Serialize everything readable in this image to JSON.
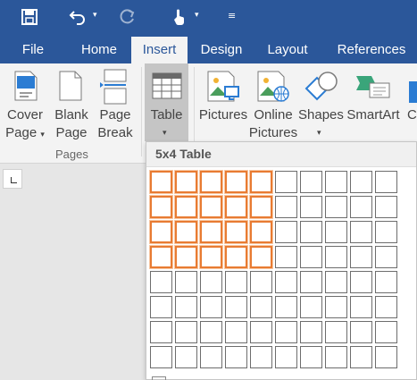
{
  "quick_access": {
    "save_icon": "save-icon",
    "undo_icon": "undo-icon",
    "redo_icon": "redo-icon",
    "touch_icon": "touch-mode-icon",
    "customize_icon": "customize-icon"
  },
  "tabs": [
    {
      "label": "File",
      "active": false
    },
    {
      "label": "Home",
      "active": false
    },
    {
      "label": "Insert",
      "active": true
    },
    {
      "label": "Design",
      "active": false
    },
    {
      "label": "Layout",
      "active": false
    },
    {
      "label": "References",
      "active": false
    }
  ],
  "ribbon": {
    "cover_page": {
      "line1": "Cover",
      "line2": "Page"
    },
    "blank_page": {
      "line1": "Blank",
      "line2": "Page"
    },
    "page_break": {
      "line1": "Page",
      "line2": "Break"
    },
    "pages_group": "Pages",
    "table": {
      "label": "Table"
    },
    "pictures": {
      "label": "Pictures"
    },
    "online_pictures": {
      "line1": "Online",
      "line2": "Pictures"
    },
    "shapes": {
      "label": "Shapes"
    },
    "smartart": {
      "label": "SmartArt"
    },
    "chart_partial": "Ch"
  },
  "dropdown": {
    "title": "5x4 Table",
    "grid_columns": 10,
    "grid_rows": 8,
    "selected_columns": 5,
    "selected_rows": 4
  },
  "colors": {
    "accent": "#2b579a",
    "highlight": "#e87b32"
  }
}
